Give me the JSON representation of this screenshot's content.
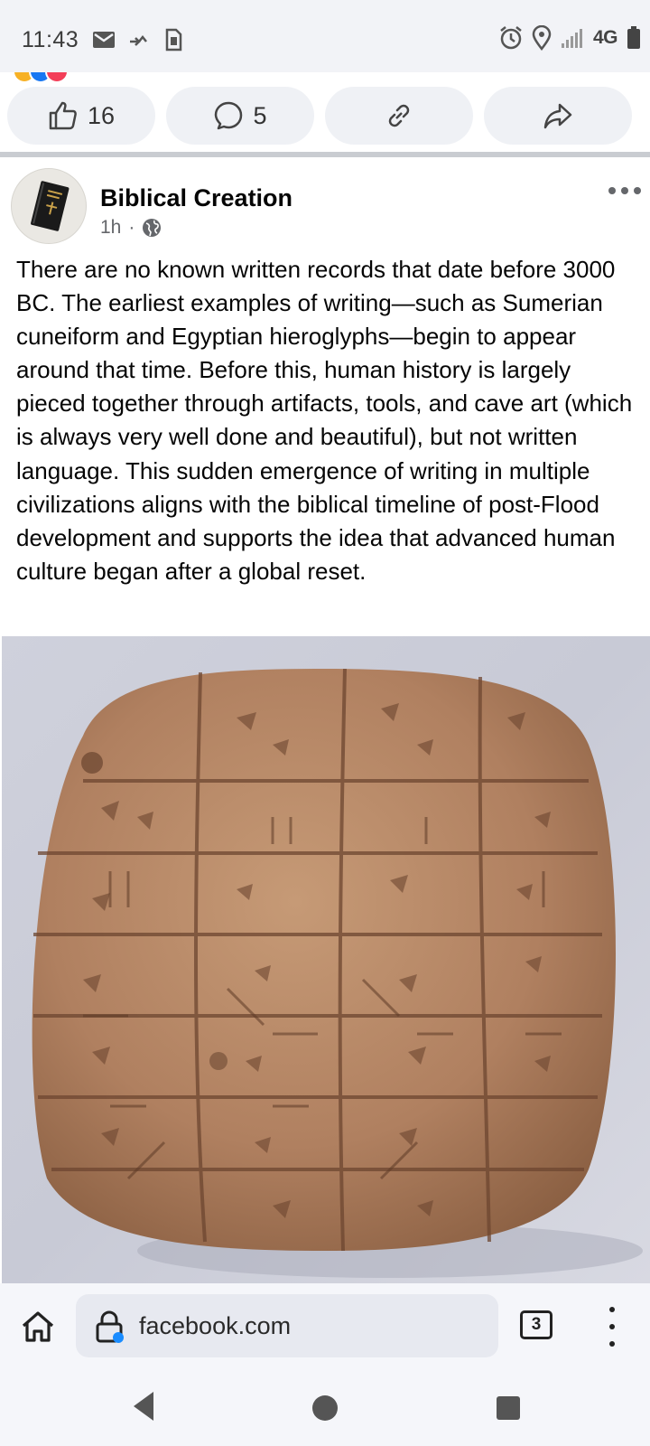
{
  "status_bar": {
    "time": "11:43",
    "network_label": "4G",
    "icons": [
      "mail-icon",
      "missed-call-icon",
      "sim-icon",
      "alarm-icon",
      "location-icon",
      "signal-icon",
      "battery-icon"
    ]
  },
  "feed": {
    "prev_post_actions": {
      "like_count": "16",
      "comment_count": "5",
      "icons": [
        "like-icon",
        "comment-icon",
        "link-icon",
        "share-icon"
      ]
    },
    "post": {
      "author": "Biblical Creation",
      "time": "1h",
      "separator": "·",
      "audience_icon": "globe-icon",
      "text": "There are no known written records that date before 3000 BC. The earliest examples of writing—such as Sumerian cuneiform and Egyptian hieroglyphs—begin to appear around that time. Before this, human history is largely pieced together through artifacts, tools, and cave art (which is always very well done and beautiful), but not written language. This sudden emergence of writing in multiple civilizations aligns with the biblical timeline of post-Flood development and supports the idea that advanced human culture began after a global reset."
    }
  },
  "browser": {
    "url": "facebook.com",
    "tab_count": "3",
    "icons": [
      "home-icon",
      "lock-icon",
      "tabs-icon",
      "menu-icon"
    ]
  },
  "colors": {
    "status_bg": "#f2f3f7",
    "pill_bg": "#eff1f5",
    "divider": "#c9ccd1",
    "secondary_text": "#65676b",
    "clay": "#b88a66"
  }
}
